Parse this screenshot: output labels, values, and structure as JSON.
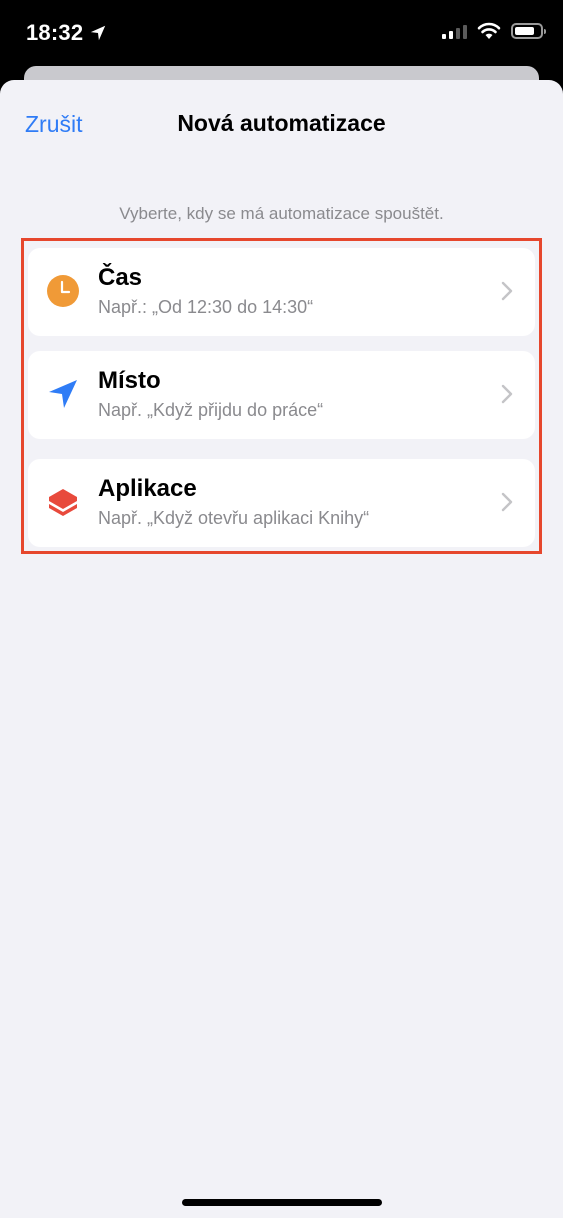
{
  "status_bar": {
    "time": "18:32",
    "battery_level": 0.78
  },
  "header": {
    "cancel_label": "Zrušit",
    "title": "Nová automatizace"
  },
  "hint": "Vyberte, kdy se má automatizace spouštět.",
  "options": [
    {
      "title": "Čas",
      "subtitle": "Např.: „Od 12:30 do 14:30“",
      "icon": "clock-icon",
      "color": "#f09a37"
    },
    {
      "title": "Místo",
      "subtitle": "Např. „Když přijdu do práce“",
      "icon": "location-arrow-icon",
      "color": "#2f7cf6"
    },
    {
      "title": "Aplikace",
      "subtitle": "Např. „Když otevřu aplikaci Knihy“",
      "icon": "app-layers-icon",
      "color": "#e84a3c"
    }
  ],
  "colors": {
    "accent": "#2f7cf6",
    "highlight": "#e6472d",
    "background": "#f2f2f7"
  }
}
